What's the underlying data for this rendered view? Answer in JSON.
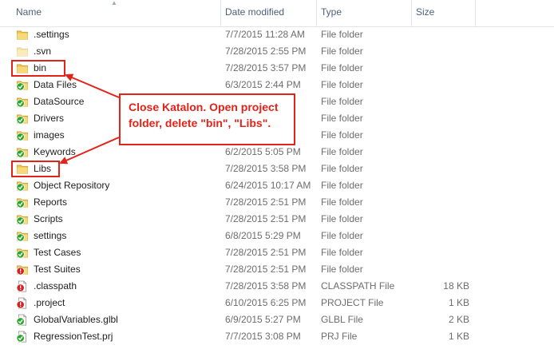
{
  "columns": {
    "name": "Name",
    "date": "Date modified",
    "type": "Type",
    "size": "Size"
  },
  "rows": [
    {
      "name": ".settings",
      "date": "7/7/2015 11:28 AM",
      "type": "File folder",
      "size": "",
      "icon": "folder-icon"
    },
    {
      "name": ".svn",
      "date": "7/28/2015 2:55 PM",
      "type": "File folder",
      "size": "",
      "icon": "folder-faded-icon"
    },
    {
      "name": "bin",
      "date": "7/28/2015 3:57 PM",
      "type": "File folder",
      "size": "",
      "icon": "folder-icon"
    },
    {
      "name": "Data Files",
      "date": "6/3/2015 2:44 PM",
      "type": "File folder",
      "size": "",
      "icon": "folder-green-check-icon"
    },
    {
      "name": "DataSource",
      "date": "",
      "type": "File folder",
      "size": "",
      "icon": "folder-green-check-icon"
    },
    {
      "name": "Drivers",
      "date": "",
      "type": "File folder",
      "size": "",
      "icon": "folder-green-check-icon"
    },
    {
      "name": "images",
      "date": "",
      "type": "File folder",
      "size": "",
      "icon": "folder-green-check-icon"
    },
    {
      "name": "Keywords",
      "date": "6/2/2015 5:05 PM",
      "type": "File folder",
      "size": "",
      "icon": "folder-green-check-icon"
    },
    {
      "name": "Libs",
      "date": "7/28/2015 3:58 PM",
      "type": "File folder",
      "size": "",
      "icon": "folder-icon"
    },
    {
      "name": "Object Repository",
      "date": "6/24/2015 10:17 AM",
      "type": "File folder",
      "size": "",
      "icon": "folder-green-check-icon"
    },
    {
      "name": "Reports",
      "date": "7/28/2015 2:51 PM",
      "type": "File folder",
      "size": "",
      "icon": "folder-green-check-icon"
    },
    {
      "name": "Scripts",
      "date": "7/28/2015 2:51 PM",
      "type": "File folder",
      "size": "",
      "icon": "folder-green-check-icon"
    },
    {
      "name": "settings",
      "date": "6/8/2015 5:29 PM",
      "type": "File folder",
      "size": "",
      "icon": "folder-green-check-icon"
    },
    {
      "name": "Test Cases",
      "date": "7/28/2015 2:51 PM",
      "type": "File folder",
      "size": "",
      "icon": "folder-green-check-icon"
    },
    {
      "name": "Test Suites",
      "date": "7/28/2015 2:51 PM",
      "type": "File folder",
      "size": "",
      "icon": "folder-red-alert-icon"
    },
    {
      "name": ".classpath",
      "date": "7/28/2015 3:58 PM",
      "type": "CLASSPATH File",
      "size": "18 KB",
      "icon": "file-red-alert-icon"
    },
    {
      "name": ".project",
      "date": "6/10/2015 6:25 PM",
      "type": "PROJECT File",
      "size": "1 KB",
      "icon": "file-red-alert-icon"
    },
    {
      "name": "GlobalVariables.glbl",
      "date": "6/9/2015 5:27 PM",
      "type": "GLBL File",
      "size": "2 KB",
      "icon": "file-green-check-icon"
    },
    {
      "name": "RegressionTest.prj",
      "date": "7/7/2015 3:08 PM",
      "type": "PRJ File",
      "size": "1 KB",
      "icon": "file-green-check-icon"
    }
  ],
  "callout": {
    "line1": "Close Katalon. Open project",
    "line2": "folder, delete \"bin\", \"Libs\"."
  },
  "colors": {
    "annotation": "#e32219",
    "folder": "#f0c24f",
    "check": "#2aa52a",
    "alert": "#d42121",
    "header_text": "#4c607a"
  }
}
